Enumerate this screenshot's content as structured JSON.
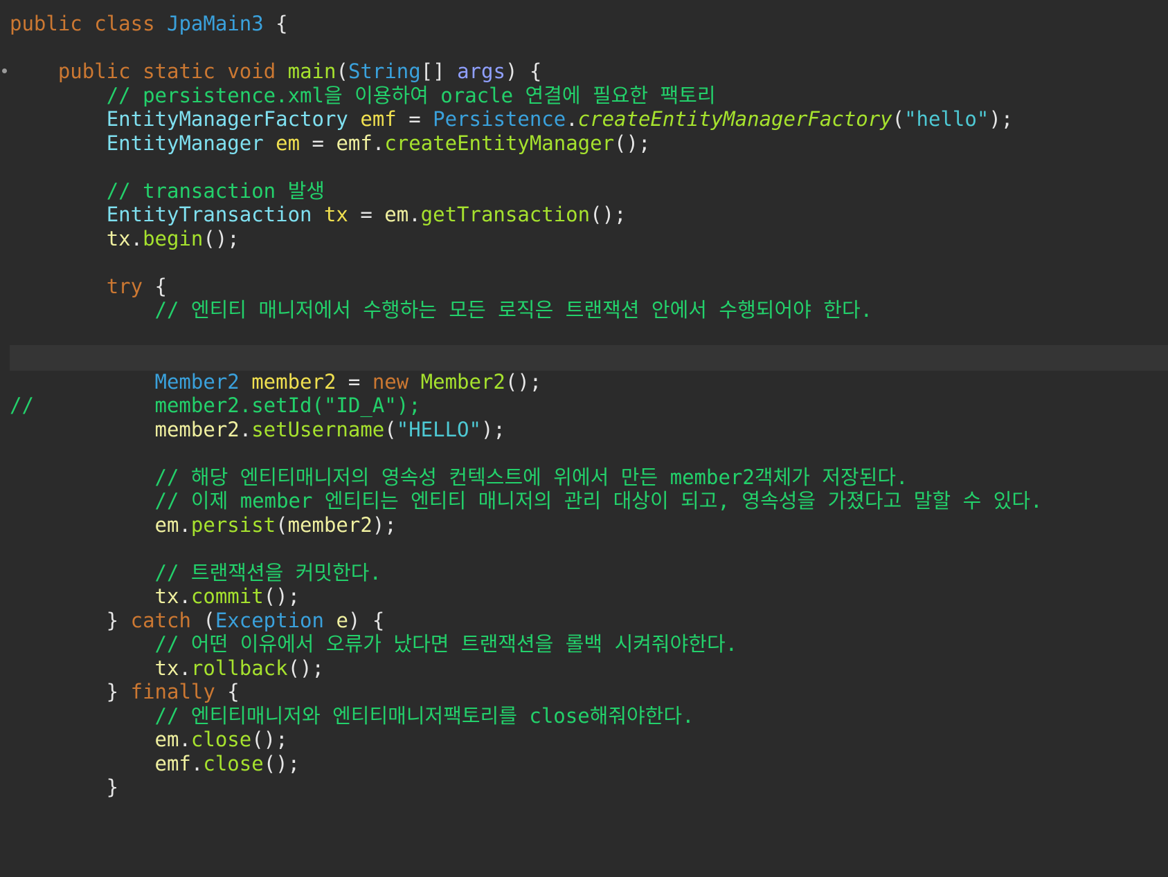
{
  "editor": {
    "lines": [
      {
        "tokens": [
          {
            "t": "public",
            "c": "kw"
          },
          {
            "t": " ",
            "c": "plain"
          },
          {
            "t": "class",
            "c": "kw"
          },
          {
            "t": " ",
            "c": "plain"
          },
          {
            "t": "JpaMain3",
            "c": "cls"
          },
          {
            "t": " {",
            "c": "plain"
          }
        ]
      },
      {
        "tokens": []
      },
      {
        "tokens": [
          {
            "t": "    ",
            "c": "plain"
          },
          {
            "t": "public",
            "c": "kw"
          },
          {
            "t": " ",
            "c": "plain"
          },
          {
            "t": "static",
            "c": "kw"
          },
          {
            "t": " ",
            "c": "plain"
          },
          {
            "t": "void",
            "c": "kw"
          },
          {
            "t": " ",
            "c": "plain"
          },
          {
            "t": "main",
            "c": "fn"
          },
          {
            "t": "(",
            "c": "plain"
          },
          {
            "t": "String",
            "c": "cls"
          },
          {
            "t": "[] ",
            "c": "plain"
          },
          {
            "t": "args",
            "c": "par"
          },
          {
            "t": ") {",
            "c": "plain"
          }
        ]
      },
      {
        "tokens": [
          {
            "t": "        ",
            "c": "plain"
          },
          {
            "t": "// persistence.xml을 이용하여 oracle 연결에 필요한 팩토리",
            "c": "cm"
          }
        ]
      },
      {
        "tokens": [
          {
            "t": "        ",
            "c": "plain"
          },
          {
            "t": "EntityManagerFactory",
            "c": "typ"
          },
          {
            "t": " ",
            "c": "plain"
          },
          {
            "t": "emf",
            "c": "lvar"
          },
          {
            "t": " = ",
            "c": "plain"
          },
          {
            "t": "Persistence",
            "c": "cls"
          },
          {
            "t": ".",
            "c": "plain"
          },
          {
            "t": "createEntityManagerFactory",
            "c": "fni"
          },
          {
            "t": "(",
            "c": "plain"
          },
          {
            "t": "\"hello\"",
            "c": "str"
          },
          {
            "t": ");",
            "c": "plain"
          }
        ]
      },
      {
        "tokens": [
          {
            "t": "        ",
            "c": "plain"
          },
          {
            "t": "EntityManager",
            "c": "typ"
          },
          {
            "t": " ",
            "c": "plain"
          },
          {
            "t": "em",
            "c": "lvar"
          },
          {
            "t": " = ",
            "c": "plain"
          },
          {
            "t": "emf",
            "c": "var"
          },
          {
            "t": ".",
            "c": "plain"
          },
          {
            "t": "createEntityManager",
            "c": "fn"
          },
          {
            "t": "();",
            "c": "plain"
          }
        ]
      },
      {
        "tokens": []
      },
      {
        "tokens": [
          {
            "t": "        ",
            "c": "plain"
          },
          {
            "t": "// transaction 발생",
            "c": "cm"
          }
        ]
      },
      {
        "tokens": [
          {
            "t": "        ",
            "c": "plain"
          },
          {
            "t": "EntityTransaction",
            "c": "typ"
          },
          {
            "t": " ",
            "c": "plain"
          },
          {
            "t": "tx",
            "c": "lvar"
          },
          {
            "t": " = ",
            "c": "plain"
          },
          {
            "t": "em",
            "c": "var"
          },
          {
            "t": ".",
            "c": "plain"
          },
          {
            "t": "getTransaction",
            "c": "fn"
          },
          {
            "t": "();",
            "c": "plain"
          }
        ]
      },
      {
        "tokens": [
          {
            "t": "        ",
            "c": "plain"
          },
          {
            "t": "tx",
            "c": "var"
          },
          {
            "t": ".",
            "c": "plain"
          },
          {
            "t": "begin",
            "c": "fn"
          },
          {
            "t": "();",
            "c": "plain"
          }
        ]
      },
      {
        "tokens": []
      },
      {
        "tokens": [
          {
            "t": "        ",
            "c": "plain"
          },
          {
            "t": "try",
            "c": "kw"
          },
          {
            "t": " {",
            "c": "plain"
          }
        ]
      },
      {
        "tokens": [
          {
            "t": "            ",
            "c": "plain"
          },
          {
            "t": "// 엔티티 매니저에서 수행하는 모든 로직은 트랜잭션 안에서 수행되어야 한다.",
            "c": "cm"
          }
        ]
      },
      {
        "tokens": []
      },
      {
        "tokens": [],
        "highlight": true
      },
      {
        "tokens": [
          {
            "t": "            ",
            "c": "plain"
          },
          {
            "t": "Member2",
            "c": "cls"
          },
          {
            "t": " ",
            "c": "plain"
          },
          {
            "t": "member2",
            "c": "lvar"
          },
          {
            "t": " = ",
            "c": "plain"
          },
          {
            "t": "new",
            "c": "kw"
          },
          {
            "t": " ",
            "c": "plain"
          },
          {
            "t": "Member2",
            "c": "fn"
          },
          {
            "t": "();",
            "c": "plain"
          }
        ]
      },
      {
        "tokens": [
          {
            "t": "//          ",
            "c": "cm"
          },
          {
            "t": "member2.setId(\"ID_A\");",
            "c": "cm"
          }
        ]
      },
      {
        "tokens": [
          {
            "t": "            ",
            "c": "plain"
          },
          {
            "t": "member2",
            "c": "var"
          },
          {
            "t": ".",
            "c": "plain"
          },
          {
            "t": "setUsername",
            "c": "fn"
          },
          {
            "t": "(",
            "c": "plain"
          },
          {
            "t": "\"HELLO\"",
            "c": "str"
          },
          {
            "t": ");",
            "c": "plain"
          }
        ]
      },
      {
        "tokens": []
      },
      {
        "tokens": [
          {
            "t": "            ",
            "c": "plain"
          },
          {
            "t": "// 해당 엔티티매니저의 영속성 컨텍스트에 위에서 만든 member2객체가 저장된다.",
            "c": "cm"
          }
        ]
      },
      {
        "tokens": [
          {
            "t": "            ",
            "c": "plain"
          },
          {
            "t": "// 이제 member 엔티티는 엔티티 매니저의 관리 대상이 되고, 영속성을 가졌다고 말할 수 있다.",
            "c": "cm"
          }
        ]
      },
      {
        "tokens": [
          {
            "t": "            ",
            "c": "plain"
          },
          {
            "t": "em",
            "c": "var"
          },
          {
            "t": ".",
            "c": "plain"
          },
          {
            "t": "persist",
            "c": "fn"
          },
          {
            "t": "(",
            "c": "plain"
          },
          {
            "t": "member2",
            "c": "var"
          },
          {
            "t": ");",
            "c": "plain"
          }
        ]
      },
      {
        "tokens": []
      },
      {
        "tokens": [
          {
            "t": "            ",
            "c": "plain"
          },
          {
            "t": "// 트랜잭션을 커밋한다.",
            "c": "cm"
          }
        ]
      },
      {
        "tokens": [
          {
            "t": "            ",
            "c": "plain"
          },
          {
            "t": "tx",
            "c": "var"
          },
          {
            "t": ".",
            "c": "plain"
          },
          {
            "t": "commit",
            "c": "fn"
          },
          {
            "t": "();",
            "c": "plain"
          }
        ]
      },
      {
        "tokens": [
          {
            "t": "        } ",
            "c": "plain"
          },
          {
            "t": "catch",
            "c": "kw"
          },
          {
            "t": " (",
            "c": "plain"
          },
          {
            "t": "Exception",
            "c": "cls"
          },
          {
            "t": " ",
            "c": "plain"
          },
          {
            "t": "e",
            "c": "var"
          },
          {
            "t": ") {",
            "c": "plain"
          }
        ]
      },
      {
        "tokens": [
          {
            "t": "            ",
            "c": "plain"
          },
          {
            "t": "// 어떤 이유에서 오류가 났다면 트랜잭션을 롤백 시켜줘야한다.",
            "c": "cm"
          }
        ]
      },
      {
        "tokens": [
          {
            "t": "            ",
            "c": "plain"
          },
          {
            "t": "tx",
            "c": "var"
          },
          {
            "t": ".",
            "c": "plain"
          },
          {
            "t": "rollback",
            "c": "fn"
          },
          {
            "t": "();",
            "c": "plain"
          }
        ]
      },
      {
        "tokens": [
          {
            "t": "        } ",
            "c": "plain"
          },
          {
            "t": "finally",
            "c": "kw"
          },
          {
            "t": " {",
            "c": "plain"
          }
        ]
      },
      {
        "tokens": [
          {
            "t": "            ",
            "c": "plain"
          },
          {
            "t": "// 엔티티매니저와 엔티티매니저팩토리를 close해줘야한다.",
            "c": "cm"
          }
        ]
      },
      {
        "tokens": [
          {
            "t": "            ",
            "c": "plain"
          },
          {
            "t": "em",
            "c": "var"
          },
          {
            "t": ".",
            "c": "plain"
          },
          {
            "t": "close",
            "c": "fn"
          },
          {
            "t": "();",
            "c": "plain"
          }
        ]
      },
      {
        "tokens": [
          {
            "t": "            ",
            "c": "plain"
          },
          {
            "t": "emf",
            "c": "var"
          },
          {
            "t": ".",
            "c": "plain"
          },
          {
            "t": "close",
            "c": "fn"
          },
          {
            "t": "();",
            "c": "plain"
          }
        ]
      },
      {
        "tokens": [
          {
            "t": "        }",
            "c": "plain"
          }
        ]
      }
    ],
    "colors": {
      "background": "#2b2b2b",
      "current_line": "#353535",
      "keyword": "#cc7832",
      "class": "#3aa1dc",
      "type": "#7fe0f0",
      "local_var": "#f0e050",
      "method": "#a6e22e",
      "string": "#4ec9d4",
      "comment": "#23d16b"
    },
    "gutter_icons": [
      "breakpoint-dot-icon"
    ]
  }
}
